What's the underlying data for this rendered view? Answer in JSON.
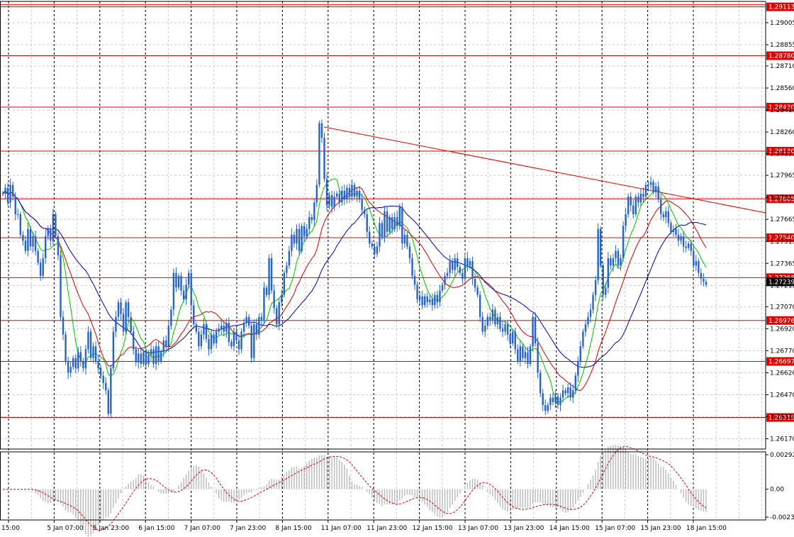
{
  "chart_data": {
    "type": "candlestick",
    "price_axis": {
      "ylim": [
        1.261,
        1.2915
      ],
      "ticks": [
        "1.29005",
        "1.28855",
        "1.28710",
        "1.28560",
        "1.28410",
        "1.28260",
        "1.28112",
        "1.27965",
        "1.27815",
        "1.27665",
        "1.27515",
        "1.27365",
        "1.27215",
        "1.27070",
        "1.26920",
        "1.26770",
        "1.26620",
        "1.26470",
        "1.26320",
        "1.26170"
      ],
      "current_price": "1.27239"
    },
    "levels": [
      "1.29113",
      "1.28780",
      "1.28430",
      "1.28130",
      "1.27805",
      "1.27540",
      "1.27268",
      "1.26976",
      "1.26697",
      "1.26315"
    ],
    "time_axis": [
      "15:00",
      "5 Jan 07:00",
      "5 Jan 23:00",
      "6 Jan 15:00",
      "7 Jan 07:00",
      "7 Jan 23:00",
      "8 Jan 15:00",
      "11 Jan 07:00",
      "11 Jan 23:00",
      "12 Jan 15:00",
      "13 Jan 07:00",
      "13 Jan 23:00",
      "14 Jan 15:00",
      "15 Jan 07:00",
      "15 Jan 23:00",
      "18 Jan 15:00"
    ],
    "osc_axis": {
      "ylim": [
        -0.00236,
        0.00292
      ],
      "ticks": [
        "0.002921",
        "0.00",
        "-0.002365"
      ]
    },
    "close": [
      1.2784,
      1.2788,
      1.2778,
      1.279,
      1.2782,
      1.277,
      1.277,
      1.2756,
      1.2752,
      1.2745,
      1.276,
      1.2748,
      1.2755,
      1.2745,
      1.2737,
      1.2728,
      1.274,
      1.2755,
      1.276,
      1.2752,
      1.277,
      1.2755,
      1.2742,
      1.27,
      1.2688,
      1.267,
      1.2662,
      1.2666,
      1.2672,
      1.2665,
      1.2676,
      1.267,
      1.2665,
      1.2678,
      1.269,
      1.2672,
      1.268,
      1.267,
      1.2665,
      1.266,
      1.2655,
      1.265,
      1.2634,
      1.2665,
      1.269,
      1.27,
      1.271,
      1.2702,
      1.269,
      1.271,
      1.27,
      1.269,
      1.2678,
      1.2669,
      1.2675,
      1.2668,
      1.2676,
      1.2668,
      1.2674,
      1.2678,
      1.2668,
      1.268,
      1.267,
      1.2676,
      1.2684,
      1.268,
      1.2694,
      1.2705,
      1.273,
      1.272,
      1.2728,
      1.2718,
      1.2712,
      1.2722,
      1.273,
      1.2708,
      1.2695,
      1.269,
      1.268,
      1.2688,
      1.2695,
      1.2685,
      1.2678,
      1.2688,
      1.2682,
      1.269,
      1.2692,
      1.2694,
      1.269,
      1.2696,
      1.2683,
      1.268,
      1.269,
      1.2684,
      1.2678,
      1.269,
      1.2696,
      1.27,
      1.2694,
      1.2672,
      1.2695,
      1.2688,
      1.27,
      1.2698,
      1.272,
      1.2715,
      1.274,
      1.2718,
      1.2706,
      1.2695,
      1.271,
      1.2715,
      1.273,
      1.2735,
      1.2745,
      1.2756,
      1.275,
      1.276,
      1.2745,
      1.2762,
      1.2755,
      1.276,
      1.2768,
      1.2766,
      1.2778,
      1.279,
      1.2832,
      1.2822,
      1.2794,
      1.2776,
      1.2783,
      1.2775,
      1.2782,
      1.2784,
      1.2778,
      1.2786,
      1.278,
      1.2788,
      1.2782,
      1.279,
      1.2782,
      1.2786,
      1.278,
      1.2773,
      1.277,
      1.2758,
      1.275,
      1.2748,
      1.2743,
      1.2748,
      1.2764,
      1.2755,
      1.2772,
      1.2758,
      1.2768,
      1.276,
      1.2768,
      1.2762,
      1.2775,
      1.275,
      1.2756,
      1.2748,
      1.274,
      1.2728,
      1.2722,
      1.2712,
      1.2714,
      1.2708,
      1.2714,
      1.271,
      1.2712,
      1.2708,
      1.2715,
      1.271,
      1.2718,
      1.2722,
      1.2728,
      1.273,
      1.2738,
      1.2732,
      1.274,
      1.2734,
      1.273,
      1.2726,
      1.274,
      1.2735,
      1.2738,
      1.2726,
      1.272,
      1.2715,
      1.27,
      1.269,
      1.2694,
      1.27,
      1.2698,
      1.2705,
      1.2695,
      1.27,
      1.2692,
      1.269,
      1.2695,
      1.2688,
      1.2682,
      1.269,
      1.2678,
      1.267,
      1.268,
      1.2672,
      1.2676,
      1.2668,
      1.268,
      1.27,
      1.2682,
      1.2662,
      1.2648,
      1.264,
      1.2636,
      1.264,
      1.2645,
      1.2642,
      1.2646,
      1.264,
      1.2645,
      1.265,
      1.2648,
      1.2652,
      1.2645,
      1.265,
      1.266,
      1.267,
      1.268,
      1.269,
      1.2695,
      1.27,
      1.2705,
      1.2715,
      1.2725,
      1.276,
      1.2735,
      1.2715,
      1.272,
      1.274,
      1.2735,
      1.274,
      1.2745,
      1.2735,
      1.274,
      1.2762,
      1.277,
      1.2782,
      1.2776,
      1.277,
      1.2782,
      1.2778,
      1.2784,
      1.2782,
      1.279,
      1.279,
      1.2792,
      1.2785,
      1.2789,
      1.278,
      1.277,
      1.2768,
      1.2772,
      1.2764,
      1.2758,
      1.276,
      1.2756,
      1.2752,
      1.2755,
      1.2748,
      1.2747,
      1.275,
      1.2745,
      1.2735,
      1.2738,
      1.273,
      1.2726,
      1.2724,
      1.2722
    ]
  }
}
